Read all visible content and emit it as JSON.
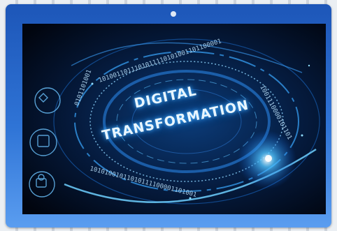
{
  "photo": {
    "headline_line1": "DIGITAL",
    "headline_line2": "TRANSFORMATION",
    "colors": {
      "frame": "#2563c9",
      "screen_bg": "#020a1c",
      "glow": "#3aa8ff",
      "text": "#e9f6ff"
    }
  }
}
